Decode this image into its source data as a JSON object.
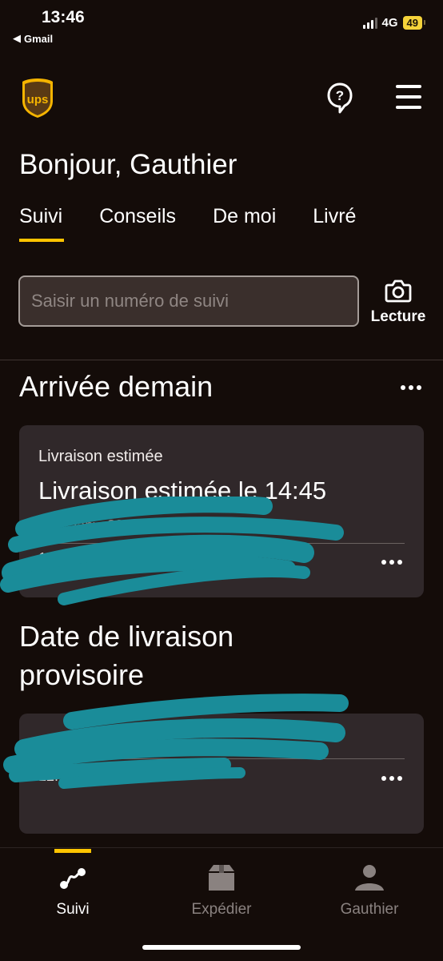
{
  "status_bar": {
    "time": "13:46",
    "back_app": "Gmail",
    "network": "4G",
    "battery": "49"
  },
  "header": {
    "logo_text": "ups",
    "greeting": "Bonjour, Gauthier"
  },
  "tabs": [
    {
      "label": "Suivi",
      "active": true
    },
    {
      "label": "Conseils",
      "active": false
    },
    {
      "label": "De moi",
      "active": false
    },
    {
      "label": "Livré",
      "active": false
    }
  ],
  "search": {
    "placeholder": "Saisir un numéro de suivi",
    "scan_label": "Lecture"
  },
  "sections": [
    {
      "title": "Arrivée demain",
      "card": {
        "label": "Livraison estimée",
        "title": "Livraison estimée le 14:45",
        "meta": "• D... janv. 20... : Corbeil Essonn...",
        "tracking": "17..."
      }
    },
    {
      "title_line1": "Date de livraison",
      "title_line2": "provisoire",
      "card": {
        "tracking": "12...94R..."
      }
    }
  ],
  "bottom_nav": [
    {
      "label": "Suivi",
      "icon": "route-icon",
      "active": true
    },
    {
      "label": "Expédier",
      "icon": "package-icon",
      "active": false
    },
    {
      "label": "Gauthier",
      "icon": "user-icon",
      "active": false
    }
  ],
  "colors": {
    "background": "#140c09",
    "accent": "#ffc400",
    "card": "#30282a",
    "redaction": "#1a8c99"
  }
}
